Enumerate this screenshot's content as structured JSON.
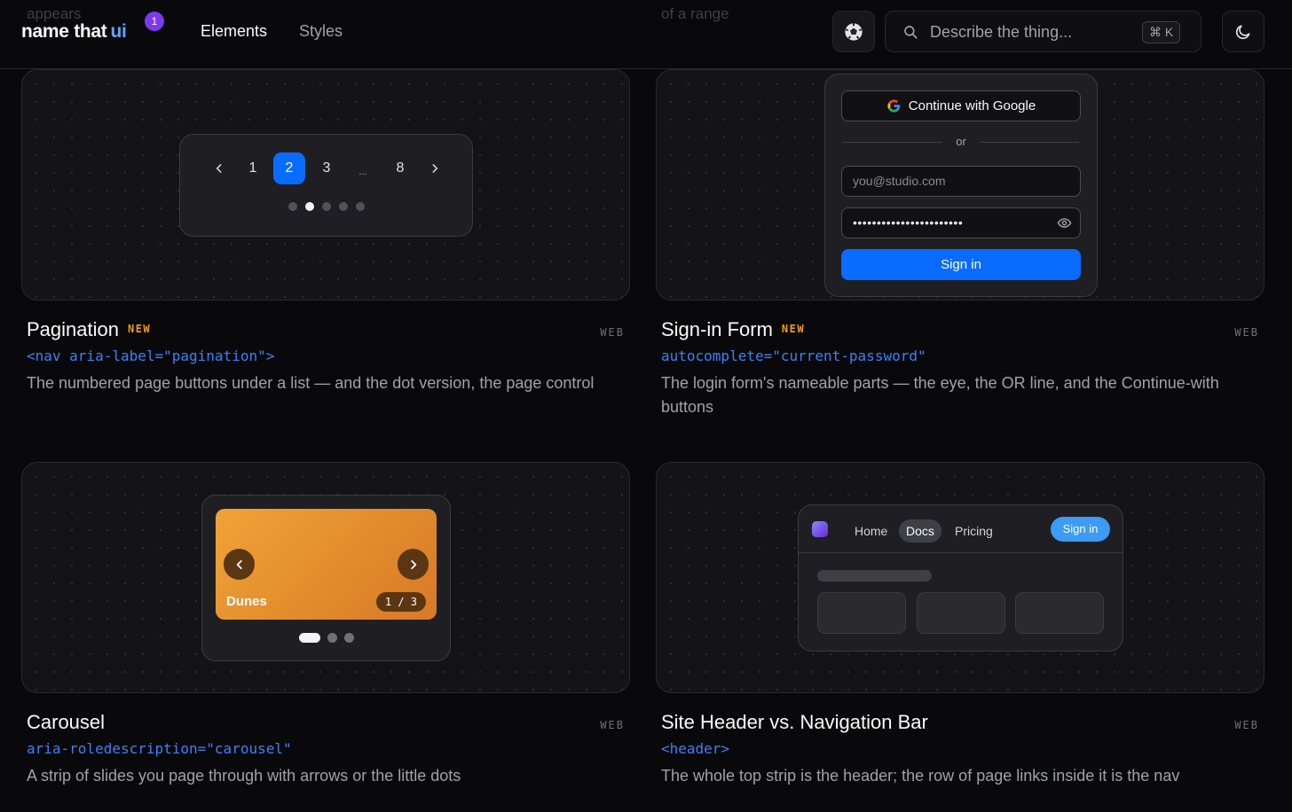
{
  "ghost_text": {
    "left": "appears",
    "right": "of a range"
  },
  "header": {
    "logo_text": "name that",
    "logo_accent": "ui",
    "logo_badge": "1",
    "nav": {
      "elements": "Elements",
      "styles": "Styles"
    },
    "search": {
      "placeholder": "Describe the thing...",
      "shortcut": "⌘ K"
    },
    "icons": {
      "ball": "soccer-ball-icon",
      "theme": "moon-icon",
      "search": "search-icon"
    }
  },
  "cards": {
    "pagination": {
      "title": "Pagination",
      "badge": "NEW",
      "platform": "WEB",
      "code": "<nav aria-label=\"pagination\">",
      "description": "The numbered page buttons under a list — and the dot version, the page control",
      "demo": {
        "prev": "‹",
        "pages": [
          "1",
          "2",
          "3",
          "...",
          "8"
        ],
        "active_page": "2",
        "next": "›",
        "dots_total": 5,
        "dots_active_index": 1
      }
    },
    "signin": {
      "title": "Sign-in Form",
      "badge": "NEW",
      "platform": "WEB",
      "code": "autocomplete=\"current-password\"",
      "description": "The login form's nameable parts — the eye, the OR line, and the Continue-with buttons",
      "demo": {
        "google_label": "Continue with Google",
        "divider_text": "or",
        "email_placeholder": "you@studio.com",
        "password_mask": "•••••••••••••••••••••••",
        "submit_label": "Sign in"
      }
    },
    "carousel": {
      "title": "Carousel",
      "platform": "WEB",
      "code": "aria-roledescription=\"carousel\"",
      "description": "A strip of slides you page through with arrows or the little dots",
      "demo": {
        "slide_name": "Dunes",
        "counter": "1 / 3",
        "dots_total": 3,
        "dots_active_index": 0
      }
    },
    "site_header": {
      "title": "Site Header vs. Navigation Bar",
      "platform": "WEB",
      "code": "<header>",
      "description": "The whole top strip is the header; the row of page links inside it is the nav",
      "demo": {
        "links": {
          "home": "Home",
          "docs": "Docs",
          "pricing": "Pricing"
        },
        "active_link": "Docs",
        "signin_label": "Sign in"
      }
    }
  },
  "colors": {
    "background": "#09090b",
    "accent_blue": "#0a6cff",
    "badge_new": "#f59e0b",
    "code_blue": "#3b82f6",
    "logo_badge": "#7c3aed"
  }
}
